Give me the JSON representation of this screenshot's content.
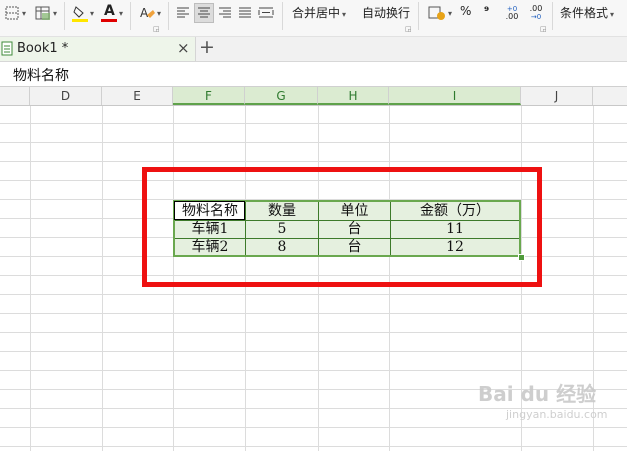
{
  "toolbar": {
    "merge_center": "合并居中",
    "auto_wrap": "自动换行",
    "percent": "%",
    "thousand_sep": "⁹",
    "conditional_format": "条件格式",
    "font_color_letter": "A",
    "caret": "▾",
    "inc_decimal": ".00",
    "dec_decimal": ".00"
  },
  "tabs": [
    {
      "label": "Book1 *",
      "close": "×"
    }
  ],
  "new_tab_label": "+",
  "formula_bar": {
    "value": "物料名称"
  },
  "columns": [
    "D",
    "E",
    "F",
    "G",
    "H",
    "I",
    "J"
  ],
  "table": {
    "header": [
      "物料名称",
      "数量",
      "单位",
      "金额（万）"
    ],
    "rows": [
      [
        "车辆1",
        "5",
        "台",
        "11"
      ],
      [
        "车辆2",
        "8",
        "台",
        "12"
      ]
    ]
  },
  "watermark": {
    "main": "Bai du 经验",
    "sub": "jingyan.baidu.com"
  },
  "colors": {
    "accent_green": "#6aa84f",
    "highlight_red": "#ee1111",
    "selection_fill": "#e5f0df"
  }
}
